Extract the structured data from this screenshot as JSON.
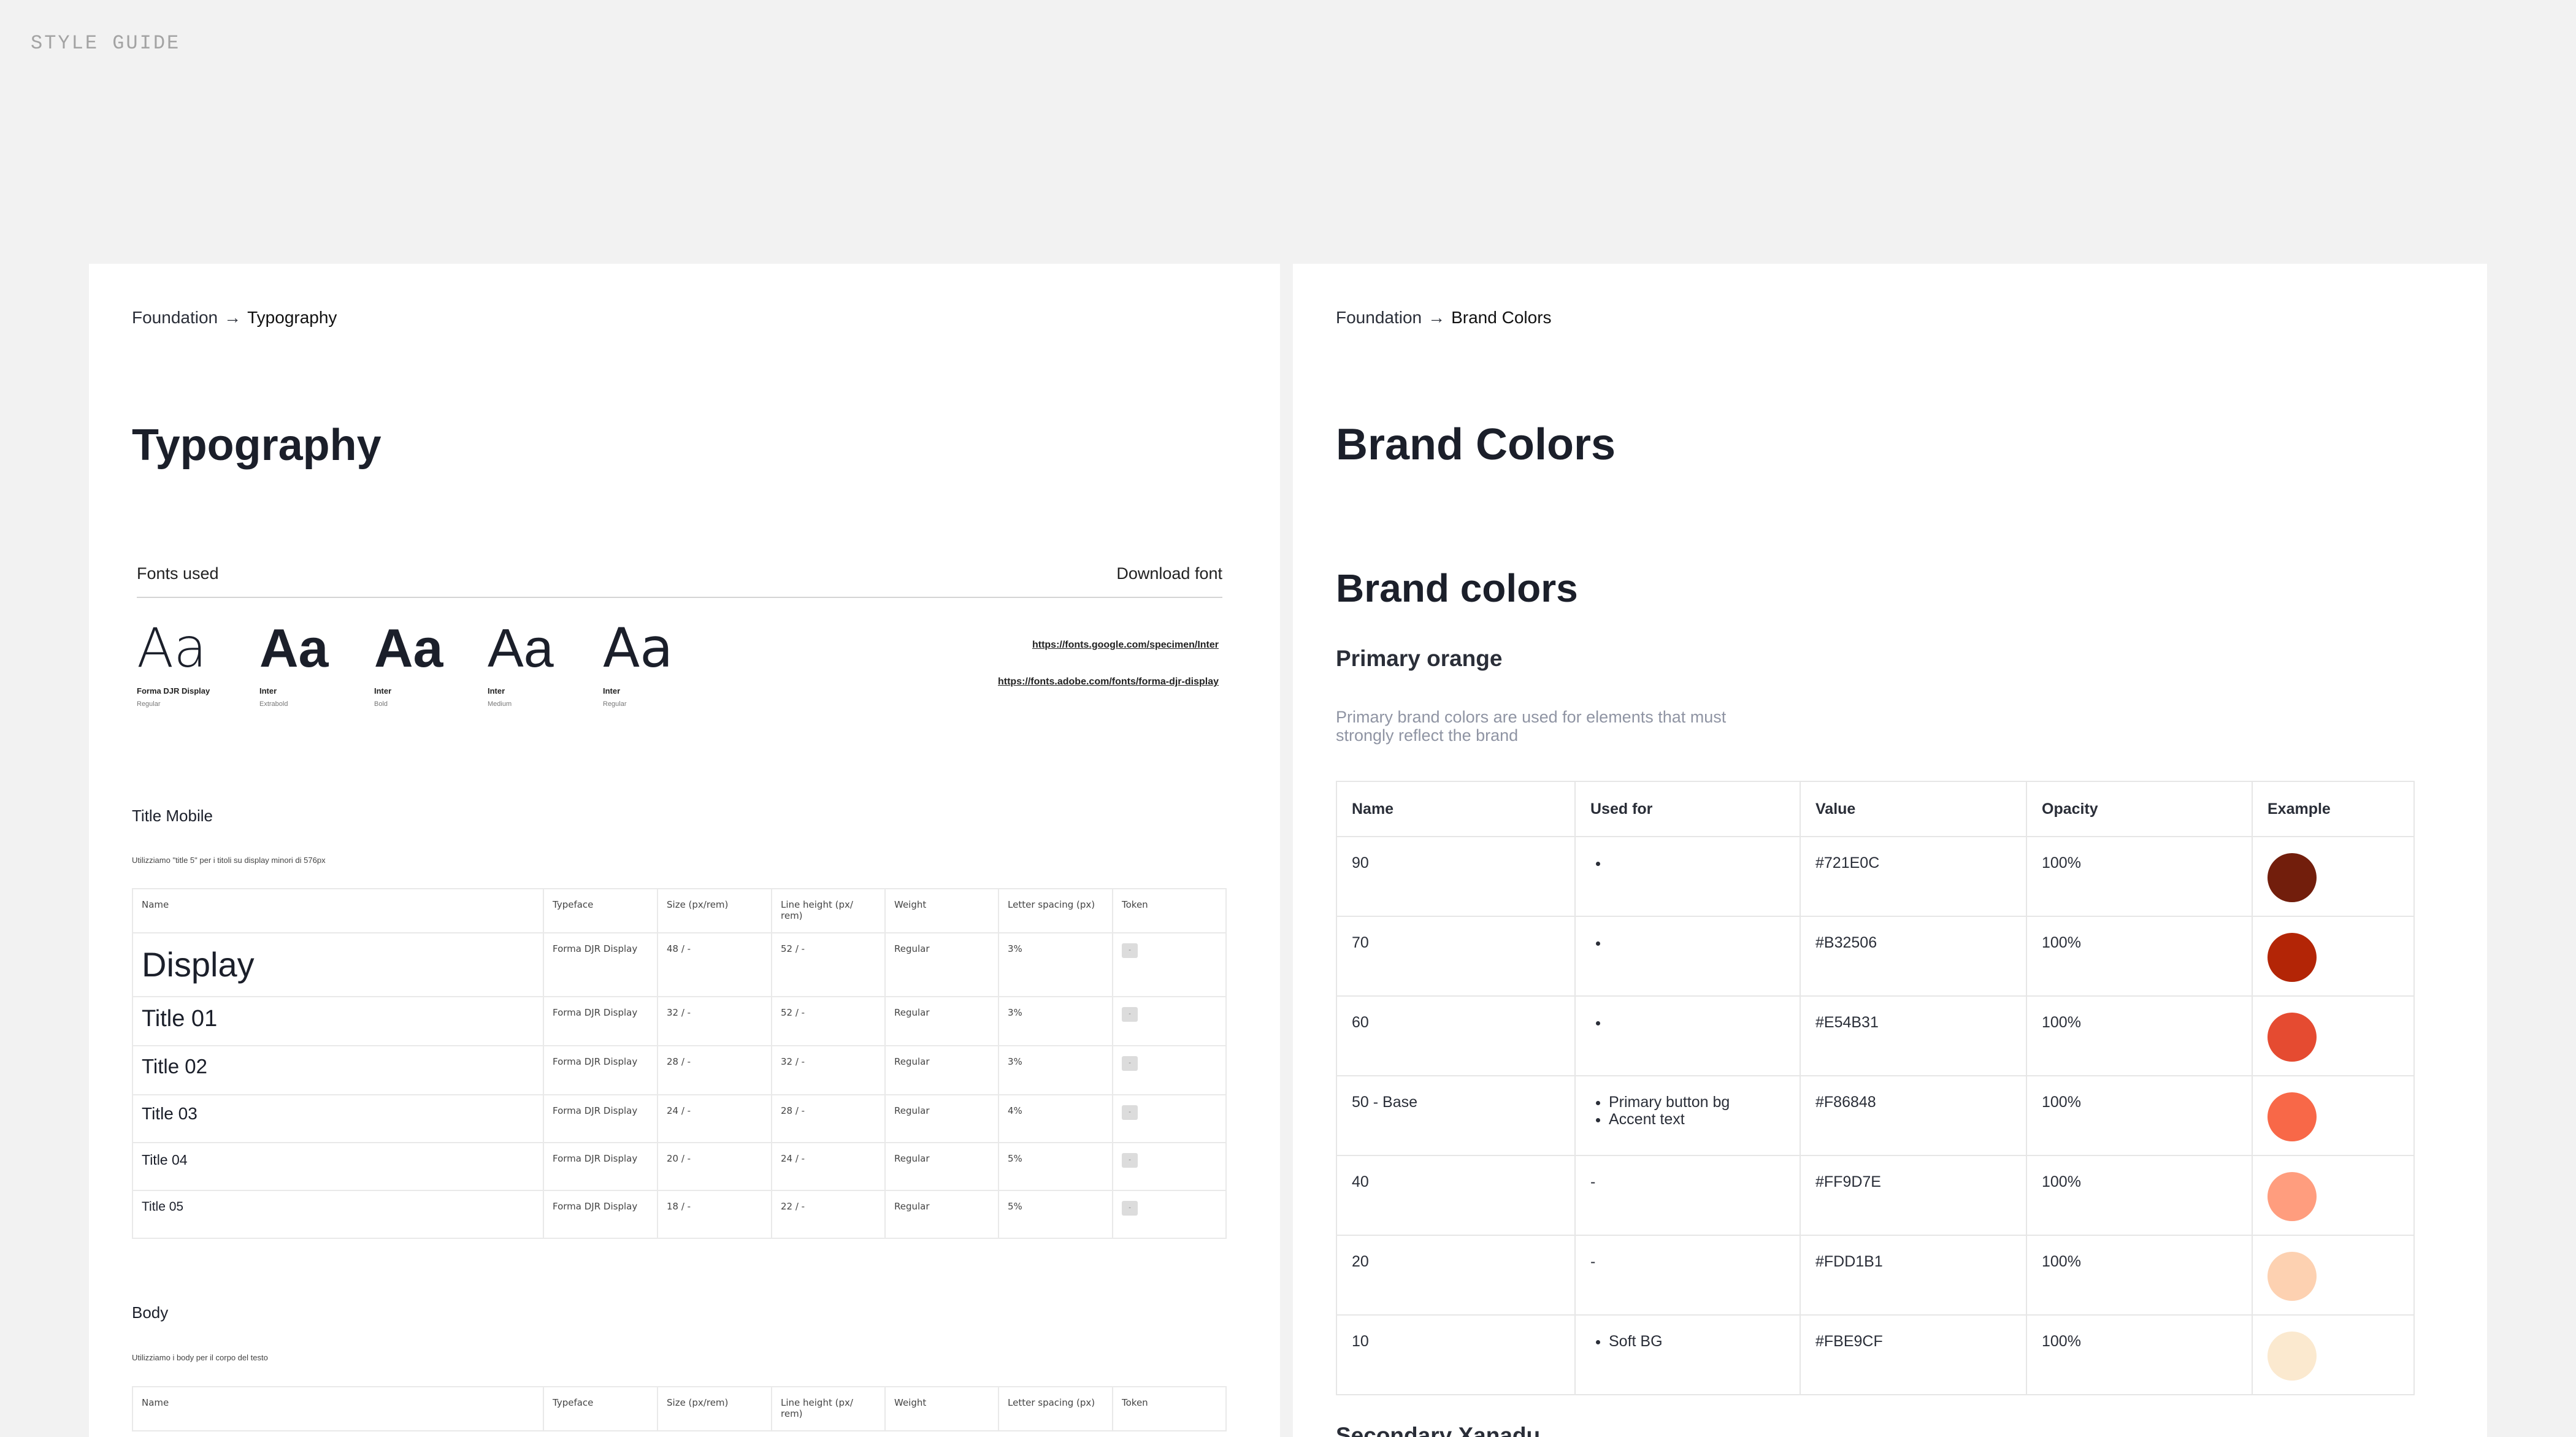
{
  "style_guide_label": "STYLE GUIDE",
  "typography": {
    "breadcrumb": {
      "root": "Foundation",
      "arrow": "→",
      "current": "Typography"
    },
    "title": "Typography",
    "fonts_used_label": "Fonts used",
    "download_label": "Download font",
    "specimens": [
      {
        "sample": "Aa",
        "name": "Forma DJR Display",
        "weight": "Regular"
      },
      {
        "sample": "Aa",
        "name": "Inter",
        "weight": "Extrabold"
      },
      {
        "sample": "Aa",
        "name": "Inter",
        "weight": "Bold"
      },
      {
        "sample": "Aa",
        "name": "Inter",
        "weight": "Medium"
      },
      {
        "sample": "Aa",
        "name": "Inter",
        "weight": "Regular"
      }
    ],
    "links": [
      "https://fonts.google.com/specimen/Inter",
      "https://fonts.adobe.com/fonts/forma-djr-display"
    ],
    "title_mobile": {
      "title": "Title Mobile",
      "note": "Utilizziamo \"title 5\" per i titoli su display minori di 576px",
      "headers": [
        "Name",
        "Typeface",
        "Size (px/rem)",
        "Line height (px/ rem)",
        "Weight",
        "Letter spacing (px)",
        "Token"
      ],
      "rows": [
        {
          "name": "Display",
          "typeface": "Forma DJR Display",
          "size": "48 / -",
          "line_height": "52 / -",
          "weight": "Regular",
          "spacing": "3%",
          "token": "-"
        },
        {
          "name": "Title 01",
          "typeface": "Forma DJR Display",
          "size": "32 / -",
          "line_height": "52 / -",
          "weight": "Regular",
          "spacing": "3%",
          "token": "-"
        },
        {
          "name": "Title  02",
          "typeface": "Forma DJR Display",
          "size": "28 / -",
          "line_height": "32 / -",
          "weight": "Regular",
          "spacing": "3%",
          "token": "-"
        },
        {
          "name": "Title  03",
          "typeface": "Forma DJR Display",
          "size": "24 / -",
          "line_height": "28 / -",
          "weight": "Regular",
          "spacing": "4%",
          "token": "-"
        },
        {
          "name": "Title  04",
          "typeface": "Forma DJR Display",
          "size": "20 / -",
          "line_height": "24 / -",
          "weight": "Regular",
          "spacing": "5%",
          "token": "-"
        },
        {
          "name": "Title  05",
          "typeface": "Forma DJR Display",
          "size": "18 / -",
          "line_height": "22 / -",
          "weight": "Regular",
          "spacing": "5%",
          "token": "-"
        }
      ]
    },
    "body": {
      "title": "Body",
      "note": "Utilizziamo i body per il corpo del testo",
      "headers": [
        "Name",
        "Typeface",
        "Size (px/rem)",
        "Line height (px/ rem)",
        "Weight",
        "Letter spacing (px)",
        "Token"
      ]
    }
  },
  "brand_colors": {
    "breadcrumb": {
      "root": "Foundation",
      "arrow": "→",
      "current": "Brand Colors"
    },
    "title": "Brand Colors",
    "section_title": "Brand colors",
    "subsection_title": "Primary orange",
    "description": "Primary brand colors are used for elements that must strongly reflect the brand",
    "headers": [
      "Name",
      "Used for",
      "Value",
      "Opacity",
      "Example"
    ],
    "rows": [
      {
        "name": "90",
        "used_for": [
          ""
        ],
        "value": "#721E0C",
        "opacity": "100%",
        "color": "#721E0C"
      },
      {
        "name": "70",
        "used_for": [
          ""
        ],
        "value": "#B32506",
        "opacity": "100%",
        "color": "#B32506"
      },
      {
        "name": "60",
        "used_for": [
          ""
        ],
        "value": "#E54B31",
        "opacity": "100%",
        "color": "#E54B31"
      },
      {
        "name": "50 - Base",
        "used_for": [
          "Primary button bg",
          "Accent text"
        ],
        "value": "#F86848",
        "opacity": "100%",
        "color": "#F86848"
      },
      {
        "name": "40",
        "used_for_text": "-",
        "value": "#FF9D7E",
        "opacity": "100%",
        "color": "#FF9D7E"
      },
      {
        "name": "20",
        "used_for_text": "-",
        "value": "#FDD1B1",
        "opacity": "100%",
        "color": "#FDD1B1"
      },
      {
        "name": "10",
        "used_for": [
          "Soft BG"
        ],
        "value": "#FBE9CF",
        "opacity": "100%",
        "color": "#FBE9CF"
      }
    ],
    "next_section_title": "Secondary Xanadu"
  }
}
